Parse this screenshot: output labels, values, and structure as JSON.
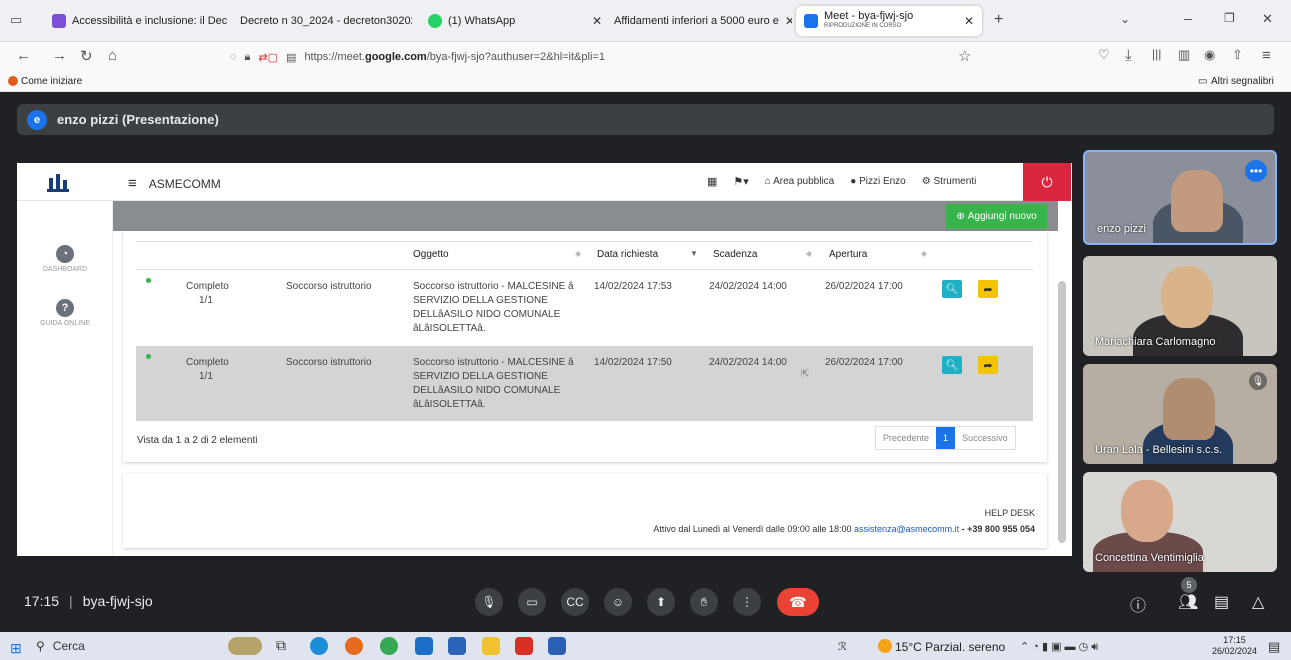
{
  "browser": {
    "tabs": [
      {
        "title": "Accessibilità e inclusione: il Dec",
        "color": "#7b4fd6"
      },
      {
        "title": "Decreto n 30_2024 - decreton30202",
        "color": ""
      },
      {
        "title": "(1) WhatsApp",
        "color": "#25d366"
      },
      {
        "title": "Affidamenti inferiori a 5000 euro e",
        "color": ""
      },
      {
        "title": "Meet - bya-fjwj-sjo",
        "subtitle": "RIPRODUZIONE IN CORSO",
        "color": "#1a73e8"
      }
    ],
    "url_prefix": "https://meet.",
    "url_domain": "google.com",
    "url_rest": "/bya-fjwj-sjo?authuser=2&hl=it&pli=1",
    "bookmark_left": "Come iniziare",
    "bookmark_right": "Altri segnalibri"
  },
  "meet": {
    "presenter_initial": "e",
    "presenter_label": "enzo pizzi (Presentazione)",
    "time": "17:15",
    "meeting_code": "bya-fjwj-sjo",
    "participant_count": "5",
    "participants": [
      {
        "name": "enzo pizzi"
      },
      {
        "name": "Mariachiara Carlomagno"
      },
      {
        "name": "Uran Lala - Bellesini s.c.s."
      },
      {
        "name": "Concettina Ventimiglia"
      }
    ]
  },
  "app": {
    "brand": "ASMECOMM",
    "nav": {
      "area": "Area pubblica",
      "user": "Pizzi Enzo",
      "tools": "Strumenti"
    },
    "add_button": "Aggiungi nuovo",
    "sidebar": [
      {
        "label": "DASHBOARD"
      },
      {
        "label": "GUIDA ONLINE"
      }
    ],
    "columns": [
      "Oggetto",
      "Data richiesta",
      "Scadenza",
      "Apertura"
    ],
    "rows": [
      {
        "stato": "Completo",
        "count": "1/1",
        "tipo": "Soccorso istruttorio",
        "oggetto": "Soccorso istruttorio - MALCESINE â SERVIZIO DELLA GESTIONE DELLâASILO NIDO COMUNALE âLâISOLETTAâ.",
        "data": "14/02/2024 17:53",
        "scadenza": "24/02/2024 14:00",
        "apertura": "26/02/2024 17:00"
      },
      {
        "stato": "Completo",
        "count": "1/1",
        "tipo": "Soccorso istruttorio",
        "oggetto": "Soccorso istruttorio - MALCESINE â SERVIZIO DELLA GESTIONE DELLâASILO NIDO COMUNALE âLâISOLETTAâ.",
        "data": "14/02/2024 17:50",
        "scadenza": "24/02/2024 14:00",
        "apertura": "26/02/2024 17:00"
      }
    ],
    "vista": "Vista da 1 a 2 di 2 elementi",
    "pager": {
      "prev": "Precedente",
      "page": "1",
      "next": "Successivo"
    },
    "helpdesk": {
      "title": "HELP DESK",
      "line": "Attivo dal Lunedì al Venerdì dalle 09:00 alle 18:00",
      "email": "assistenza@asmecomm.it",
      "phone": "- +39 800 955 054"
    }
  },
  "taskbar": {
    "search": "Cerca",
    "weather": "15°C Parzial. sereno",
    "time": "17:15",
    "date": "26/02/2024"
  }
}
